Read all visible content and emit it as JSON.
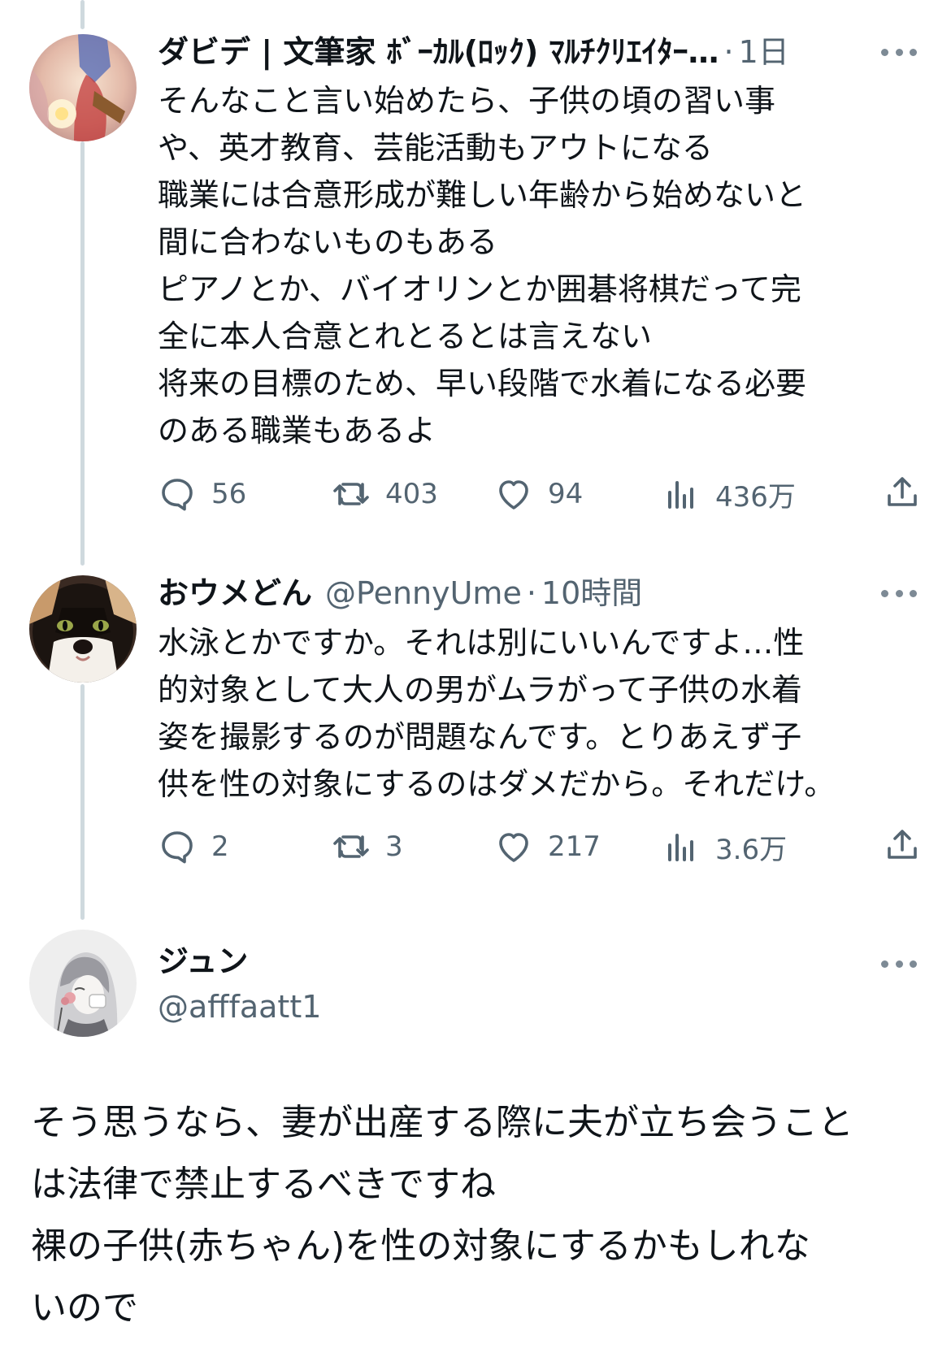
{
  "colors": {
    "text": "#0f1419",
    "secondary": "#536471",
    "thread_line": "#cfd9de"
  },
  "tweets": [
    {
      "display_name": "ダビデ | 文筆家 ﾎﾞｰｶﾙ(ﾛｯｸ) ﾏﾙﾁｸﾘｴｲﾀｰ…",
      "handle": "",
      "dot": "·",
      "time": "1日",
      "lines": [
        "そんなこと言い始めたら、子供の頃の習い事",
        "や、英才教育、芸能活動もアウトになる",
        "職業には合意形成が難しい年齢から始めないと",
        "間に合わないものもある",
        "ピアノとか、バイオリンとか囲碁将棋だって完",
        "全に本人合意とれとるとは言えない",
        "将来の目標のため、早い段階で水着になる必要",
        "のある職業もあるよ"
      ],
      "replies": "56",
      "retweets": "403",
      "likes": "94",
      "views": "436万",
      "avatar_icon": "avatar-illustration"
    },
    {
      "display_name": "おウメどん",
      "handle": "@PennyUme",
      "dot": "·",
      "time": "10時間",
      "lines": [
        "水泳とかですか。それは別にいいんですよ…性",
        "的対象として大人の男がムラがって子供の水着",
        "姿を撮影するのが問題なんです。とりあえず子",
        "供を性の対象にするのはダメだから。それだけ。"
      ],
      "replies": "2",
      "retweets": "3",
      "likes": "217",
      "views": "3.6万",
      "avatar_icon": "cat-avatar"
    }
  ],
  "main_reply": {
    "display_name": "ジュン",
    "handle": "@afffaatt1",
    "lines": [
      "そう思うなら、妻が出産する際に夫が立ち会うこと",
      "は法律で禁止するべきですね",
      "裸の子供(赤ちゃん)を性の対象にするかもしれな",
      "いので"
    ],
    "avatar_icon": "anime-avatar"
  },
  "icons": {
    "more": "more-dots-icon",
    "reply": "reply-bubble-icon",
    "retweet": "retweet-icon",
    "like": "heart-icon",
    "views": "views-bar-icon",
    "share": "share-icon"
  }
}
